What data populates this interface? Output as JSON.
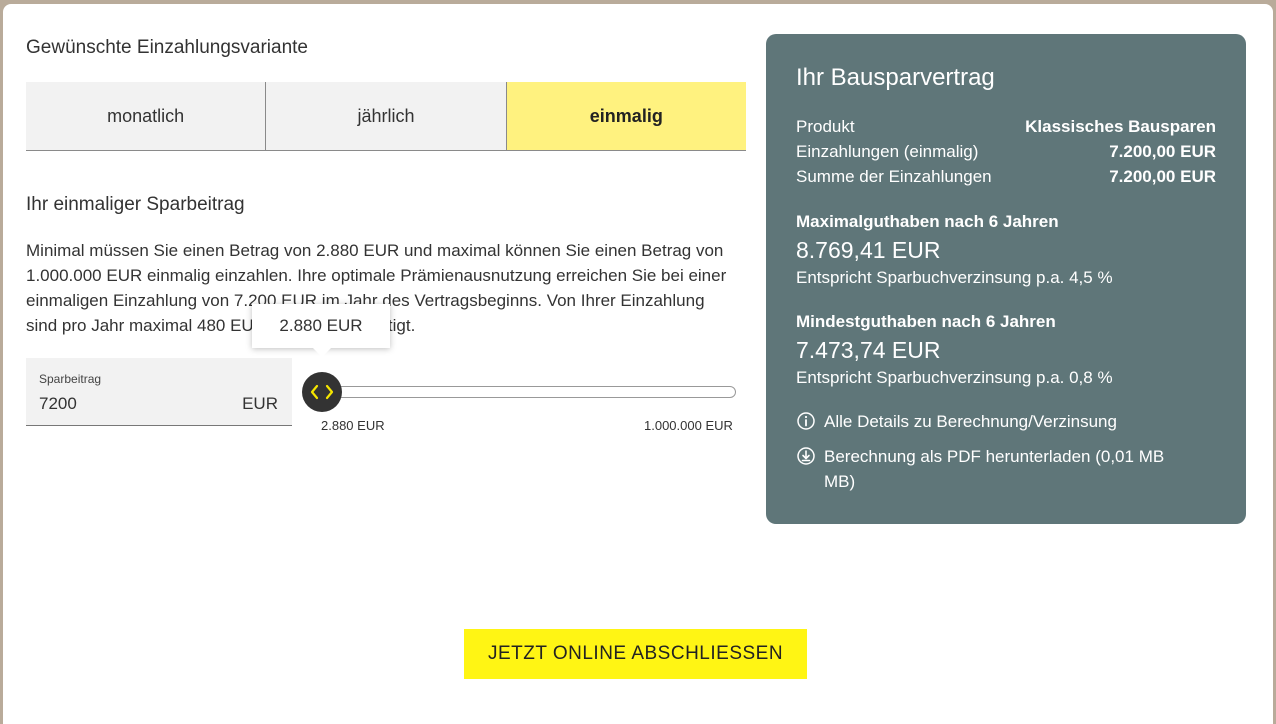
{
  "left": {
    "section_title": "Gewünschte Einzahlungsvariante",
    "tabs": [
      {
        "label": "monatlich"
      },
      {
        "label": "jährlich"
      },
      {
        "label": "einmalig"
      }
    ],
    "sub_title": "Ihr einmaliger Sparbeitrag",
    "description": "Minimal müssen Sie einen Betrag von 2.880 EUR und maximal können Sie einen Betrag von 1.000.000 EUR einmalig einzahlen. Ihre optimale Prämienausnutzung erreichen Sie bei einer einmaligen Einzahlung von 7.200 EUR im Jahr des Vertragsbeginns. Von Ihrer Einzahlung sind pro Jahr maximal 480 EUR prämienbegünstigt.",
    "tooltip": "2.880 EUR",
    "input": {
      "label": "Sparbeitrag",
      "value": "7200",
      "unit": "EUR"
    },
    "slider": {
      "min_label": "2.880 EUR",
      "max_label": "1.000.000 EUR",
      "min": 2880,
      "max": 1000000,
      "value": 2880
    }
  },
  "panel": {
    "title": "Ihr Bausparvertrag",
    "rows": [
      {
        "label": "Produkt",
        "value": "Klassisches Bausparen"
      },
      {
        "label": "Einzahlungen (einmalig)",
        "value": "7.200,00 EUR"
      },
      {
        "label": "Summe der Einzahlungen",
        "value": "7.200,00 EUR"
      }
    ],
    "max_block": {
      "heading": "Maximalguthaben nach 6 Jahren",
      "amount": "8.769,41 EUR",
      "note": "Entspricht Sparbuchverzinsung p.a. 4,5 %"
    },
    "min_block": {
      "heading": "Mindestguthaben nach 6 Jahren",
      "amount": "7.473,74 EUR",
      "note": "Entspricht Sparbuchverzinsung p.a. 0,8 %"
    },
    "links": [
      {
        "label": "Alle Details zu Berechnung/Verzinsung",
        "icon": "info-icon"
      },
      {
        "label": "Berechnung als PDF herunterladen (0,01 MB MB)",
        "icon": "download-icon"
      }
    ]
  },
  "cta": {
    "label": "JETZT ONLINE ABSCHLIESSEN"
  },
  "colors": {
    "accent_yellow": "#fff514",
    "tab_active": "#fff27f",
    "panel_bg": "#5f7679"
  }
}
